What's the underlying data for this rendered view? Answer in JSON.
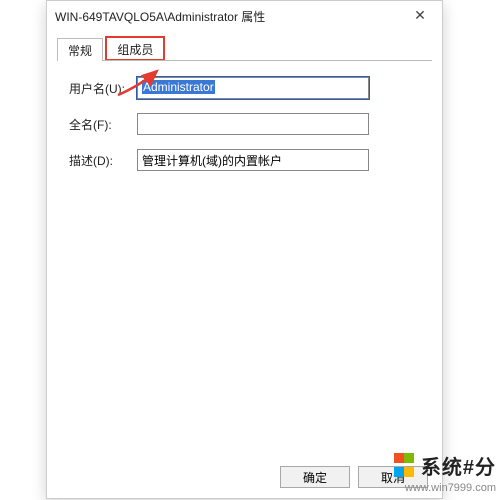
{
  "window": {
    "title": "WIN-649TAVQLO5A\\Administrator 属性",
    "close_glyph": "✕"
  },
  "tabs": {
    "general": "常规",
    "members": "组成员"
  },
  "fields": {
    "username_label": "用户名(U):",
    "username_value": "Administrator",
    "fullname_label": "全名(F):",
    "fullname_value": "",
    "description_label": "描述(D):",
    "description_value": "管理计算机(域)的内置帐户"
  },
  "buttons": {
    "ok": "确定",
    "cancel": "取消"
  },
  "watermark": {
    "title": "系统#分",
    "url": "www.win7999.com"
  }
}
